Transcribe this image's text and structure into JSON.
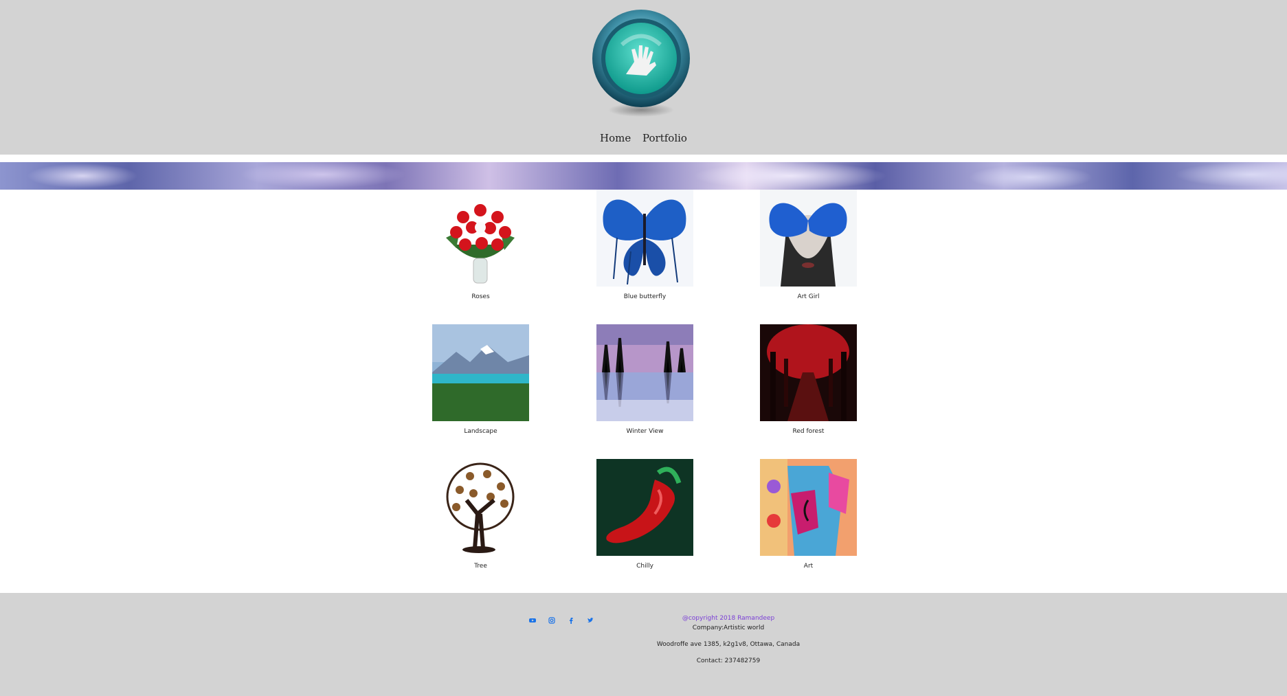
{
  "nav": {
    "home": "Home",
    "portfolio": "Portfolio"
  },
  "gallery": [
    {
      "caption": "Roses"
    },
    {
      "caption": "Blue butterfly"
    },
    {
      "caption": "Art Girl"
    },
    {
      "caption": "Landscape"
    },
    {
      "caption": "Winter View"
    },
    {
      "caption": "Red forest"
    },
    {
      "caption": "Tree"
    },
    {
      "caption": "Chilly"
    },
    {
      "caption": "Art"
    }
  ],
  "footer": {
    "copyright": "@copyright 2018 Ramandeep",
    "company": "Company:Artistic world",
    "address": "Woodroffe ave 1385, k2g1v8, Ottawa, Canada",
    "contact": "Contact: 237482759",
    "social_icons": [
      "youtube-icon",
      "instagram-icon",
      "facebook-icon",
      "twitter-icon"
    ]
  },
  "colors": {
    "header_bg": "#d3d3d3",
    "footer_bg": "#d3d3d3",
    "copyright": "#7b3fd6",
    "social": "#1a73e8"
  }
}
